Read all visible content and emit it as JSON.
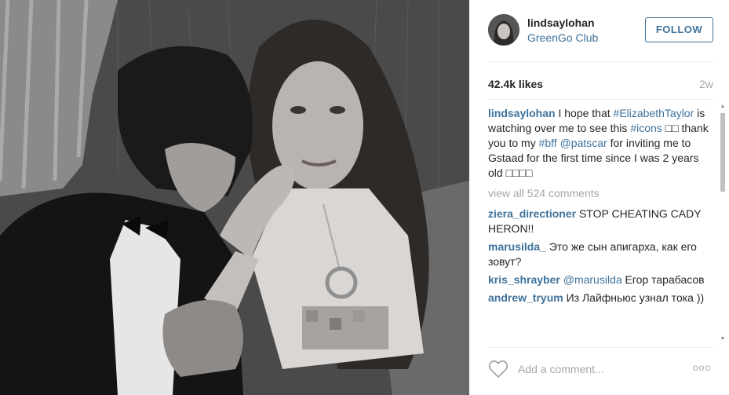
{
  "post": {
    "username": "lindsaylohan",
    "location": "GreenGo Club",
    "follow_label": "FOLLOW",
    "likes": "42.4k likes",
    "time_ago": "2w"
  },
  "caption": {
    "username": "lindsaylohan",
    "t1": " I hope that ",
    "h1": "#ElizabethTaylor",
    "t2": " is watching over me to see this ",
    "h2": "#icons",
    "t3": " □□ thank you to my ",
    "h3": "#bff",
    "t4": " ",
    "m1": "@patscar",
    "t5": " for inviting me to Gstaad for the first time since I was 2 years old □□□□"
  },
  "view_all": "view all 524 comments",
  "comments": [
    {
      "user": "ziera_directioner",
      "text": " STOP CHEATING CADY HERON!!"
    },
    {
      "user": "marusilda_",
      "text": " Это же сын апигарха, как его зовут?"
    },
    {
      "user": "kris_shrayber",
      "mention": "@marusilda",
      "text": "  Егор тарабасов"
    },
    {
      "user": "andrew_tryum",
      "text": " Из Лайфньюс узнал тока ))"
    }
  ],
  "footer": {
    "comment_placeholder": "Add a comment...",
    "more_label": "ooo"
  },
  "icons": {
    "like": "heart-outline-icon",
    "more": "more-dots-icon"
  },
  "colors": {
    "link": "#3f729b",
    "muted": "#a5a7aa",
    "text": "#262626",
    "divider": "#efefef"
  }
}
